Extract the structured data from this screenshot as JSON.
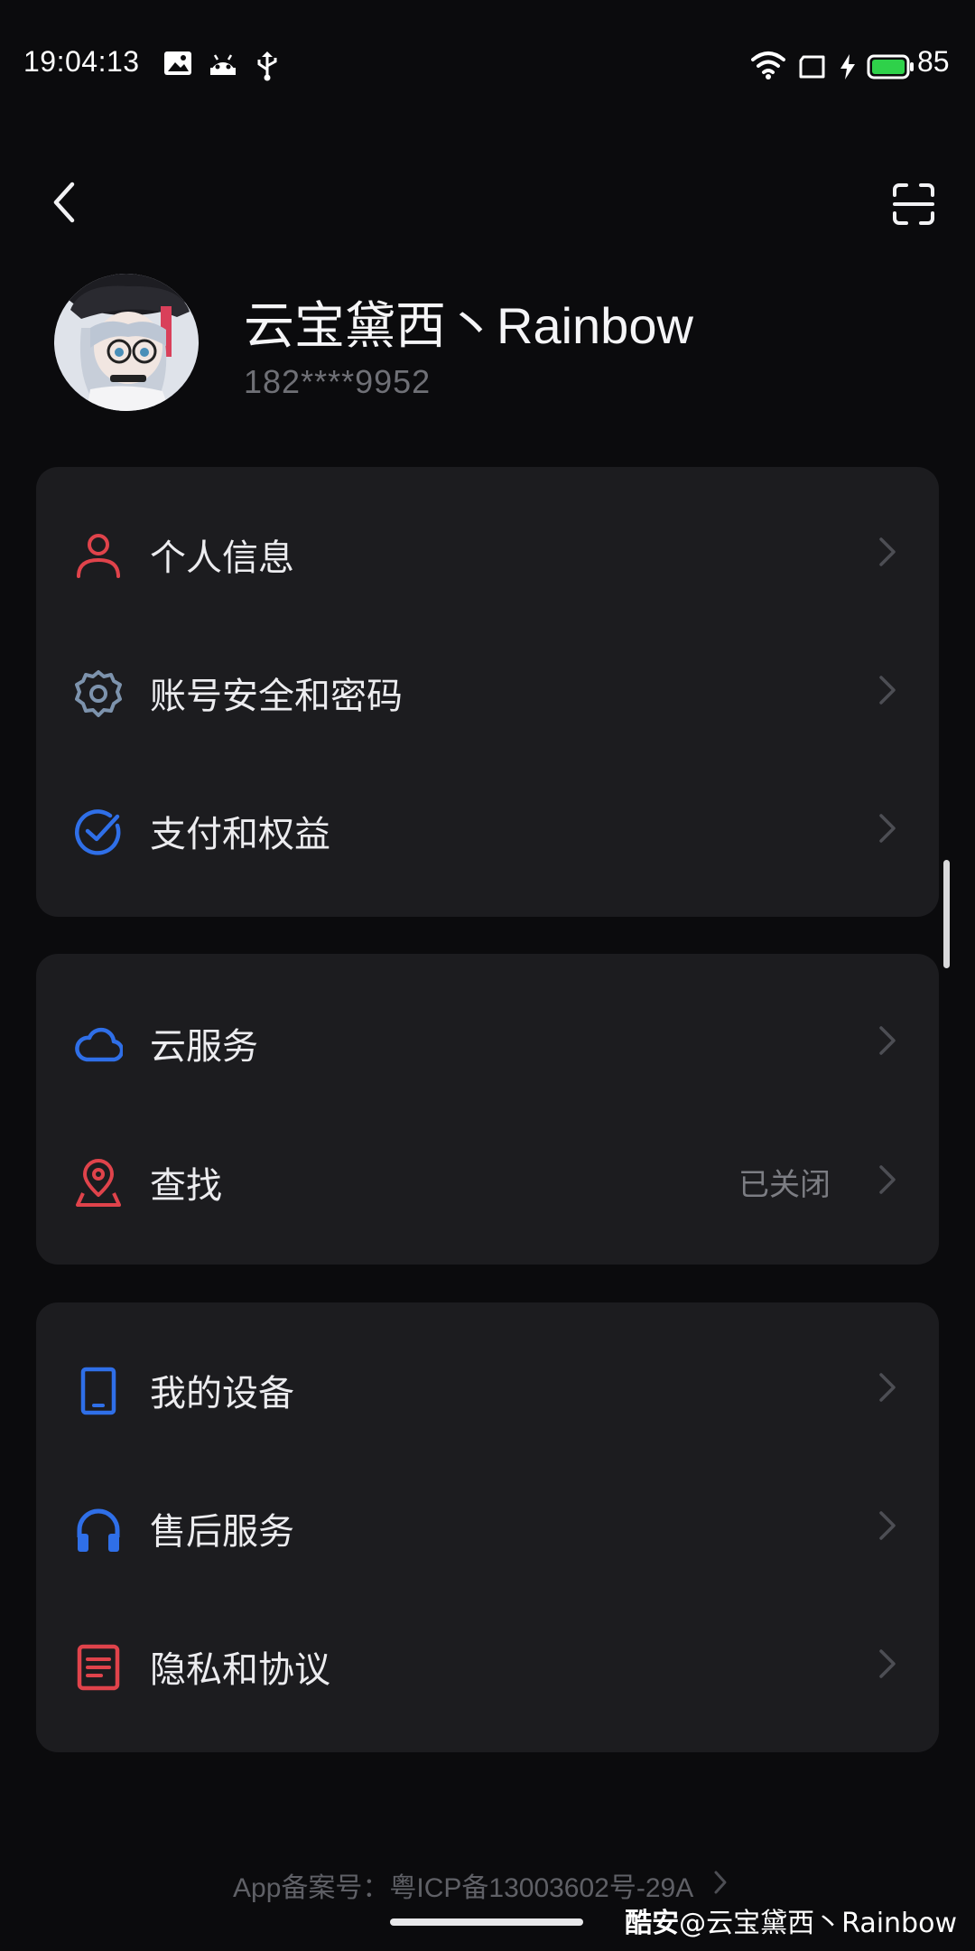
{
  "status_bar": {
    "time": "19:04:13",
    "battery": "85",
    "icons": [
      "image-notification-icon",
      "android-icon",
      "usb-icon",
      "wifi-icon",
      "sim-icon",
      "charging-icon",
      "battery-icon"
    ],
    "battery_color": "#2fd14a"
  },
  "header": {
    "back_icon": "chevron-left-icon",
    "scan_icon": "scan-icon"
  },
  "profile": {
    "name": "云宝黛西丶Rainbow",
    "phone": "182****9952"
  },
  "groups": [
    {
      "items": [
        {
          "icon": "person-icon",
          "label": "个人信息",
          "value": "",
          "icon_color": "#e0434b"
        },
        {
          "icon": "gear-icon",
          "label": "账号安全和密码",
          "value": "",
          "icon_color": "#7d93ad"
        },
        {
          "icon": "check-circle-icon",
          "label": "支付和权益",
          "value": "",
          "icon_color": "#2f6fe8"
        }
      ]
    },
    {
      "items": [
        {
          "icon": "cloud-icon",
          "label": "云服务",
          "value": "",
          "icon_color": "#2f6fe8"
        },
        {
          "icon": "location-pin-icon",
          "label": "查找",
          "value": "已关闭",
          "icon_color": "#e0434b"
        }
      ]
    },
    {
      "items": [
        {
          "icon": "phone-device-icon",
          "label": "我的设备",
          "value": "",
          "icon_color": "#2f6fe8"
        },
        {
          "icon": "headphones-icon",
          "label": "售后服务",
          "value": "",
          "icon_color": "#2f6fe8"
        },
        {
          "icon": "document-icon",
          "label": "隐私和协议",
          "value": "",
          "icon_color": "#e0434b"
        }
      ]
    }
  ],
  "footer": {
    "icp": "App备案号：粤ICP备13003602号-29A"
  },
  "watermark": {
    "brand": "酷安",
    "author": "@云宝黛西丶Rainbow"
  }
}
